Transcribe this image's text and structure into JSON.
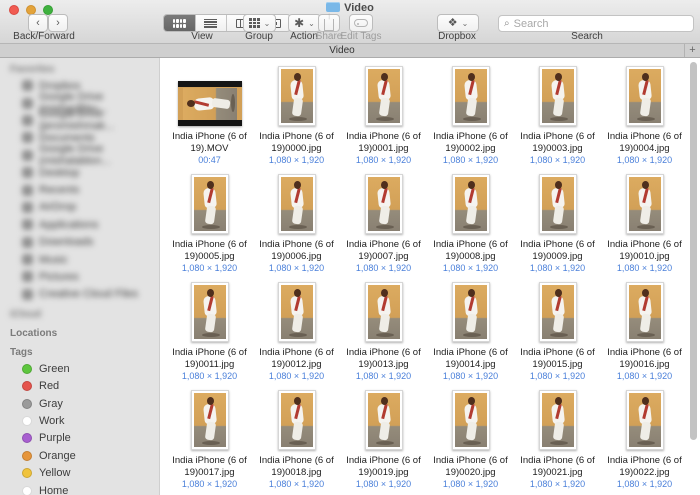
{
  "window": {
    "title": "Video"
  },
  "toolbar": {
    "back_forward_label": "Back/Forward",
    "view_label": "View",
    "group_label": "Group",
    "action_label": "Action",
    "share_label": "Share",
    "edit_tags_label": "Edit Tags",
    "dropbox_label": "Dropbox",
    "search_label": "Search",
    "search_placeholder": "Search",
    "back_glyph": "‹",
    "forward_glyph": "›",
    "chevron_glyph": "⌄",
    "gear_glyph": "✱",
    "dropbox_glyph": "❖",
    "magnifier_glyph": "⌕"
  },
  "tab_bar": {
    "tab_title": "Video",
    "new_tab_label": "+"
  },
  "sidebar": {
    "favorites_header": "Favorites",
    "favorites": [
      {
        "label": "Dropbox"
      },
      {
        "label": "Google Drive (mishaj@bu..."
      },
      {
        "label": "Google Drive (jeromishmak..."
      },
      {
        "label": "Documents"
      },
      {
        "label": "Google Drive (mishalablon..."
      },
      {
        "label": "Desktop"
      },
      {
        "label": "Recents"
      },
      {
        "label": "AirDrop"
      },
      {
        "label": "Applications"
      },
      {
        "label": "Downloads"
      },
      {
        "label": "Music"
      },
      {
        "label": "Pictures"
      },
      {
        "label": "Creative Cloud Files"
      }
    ],
    "icloud_header": "iCloud",
    "locations_header": "Locations",
    "tags_header": "Tags",
    "tags": [
      {
        "label": "Green",
        "color": "#5dc63e"
      },
      {
        "label": "Red",
        "color": "#e5544d"
      },
      {
        "label": "Gray",
        "color": "#9a9a9a"
      },
      {
        "label": "Work",
        "color": "#ffffff"
      },
      {
        "label": "Purple",
        "color": "#a85fd0"
      },
      {
        "label": "Orange",
        "color": "#e6953b"
      },
      {
        "label": "Yellow",
        "color": "#f0c33c"
      },
      {
        "label": "Home",
        "color": "#ffffff"
      }
    ]
  },
  "colors": {
    "accent_blue": "#4b80da",
    "folder_blue": "#7ab8e8"
  },
  "files": [
    {
      "type": "video",
      "line1": "India iPhone (6 of",
      "line2": "19).MOV",
      "meta": "00:47"
    },
    {
      "type": "image",
      "line1": "India iPhone (6 of",
      "line2": "19)0000.jpg",
      "meta": "1,080 × 1,920"
    },
    {
      "type": "image",
      "line1": "India iPhone (6 of",
      "line2": "19)0001.jpg",
      "meta": "1,080 × 1,920"
    },
    {
      "type": "image",
      "line1": "India iPhone (6 of",
      "line2": "19)0002.jpg",
      "meta": "1,080 × 1,920"
    },
    {
      "type": "image",
      "line1": "India iPhone (6 of",
      "line2": "19)0003.jpg",
      "meta": "1,080 × 1,920"
    },
    {
      "type": "image",
      "line1": "India iPhone (6 of",
      "line2": "19)0004.jpg",
      "meta": "1,080 × 1,920"
    },
    {
      "type": "image",
      "line1": "India iPhone (6 of",
      "line2": "19)0005.jpg",
      "meta": "1,080 × 1,920"
    },
    {
      "type": "image",
      "line1": "India iPhone (6 of",
      "line2": "19)0006.jpg",
      "meta": "1,080 × 1,920"
    },
    {
      "type": "image",
      "line1": "India iPhone (6 of",
      "line2": "19)0007.jpg",
      "meta": "1,080 × 1,920"
    },
    {
      "type": "image",
      "line1": "India iPhone (6 of",
      "line2": "19)0008.jpg",
      "meta": "1,080 × 1,920"
    },
    {
      "type": "image",
      "line1": "India iPhone (6 of",
      "line2": "19)0009.jpg",
      "meta": "1,080 × 1,920"
    },
    {
      "type": "image",
      "line1": "India iPhone (6 of",
      "line2": "19)0010.jpg",
      "meta": "1,080 × 1,920"
    },
    {
      "type": "image",
      "line1": "India iPhone (6 of",
      "line2": "19)0011.jpg",
      "meta": "1,080 × 1,920"
    },
    {
      "type": "image",
      "line1": "India iPhone (6 of",
      "line2": "19)0012.jpg",
      "meta": "1,080 × 1,920"
    },
    {
      "type": "image",
      "line1": "India iPhone (6 of",
      "line2": "19)0013.jpg",
      "meta": "1,080 × 1,920"
    },
    {
      "type": "image",
      "line1": "India iPhone (6 of",
      "line2": "19)0014.jpg",
      "meta": "1,080 × 1,920"
    },
    {
      "type": "image",
      "line1": "India iPhone (6 of",
      "line2": "19)0015.jpg",
      "meta": "1,080 × 1,920"
    },
    {
      "type": "image",
      "line1": "India iPhone (6 of",
      "line2": "19)0016.jpg",
      "meta": "1,080 × 1,920"
    },
    {
      "type": "image",
      "line1": "India iPhone (6 of",
      "line2": "19)0017.jpg",
      "meta": "1,080 × 1,920"
    },
    {
      "type": "image",
      "line1": "India iPhone (6 of",
      "line2": "19)0018.jpg",
      "meta": "1,080 × 1,920"
    },
    {
      "type": "image",
      "line1": "India iPhone (6 of",
      "line2": "19)0019.jpg",
      "meta": "1,080 × 1,920"
    },
    {
      "type": "image",
      "line1": "India iPhone (6 of",
      "line2": "19)0020.jpg",
      "meta": "1,080 × 1,920"
    },
    {
      "type": "image",
      "line1": "India iPhone (6 of",
      "line2": "19)0021.jpg",
      "meta": "1,080 × 1,920"
    },
    {
      "type": "image",
      "line1": "India iPhone (6 of",
      "line2": "19)0022.jpg",
      "meta": "1,080 × 1,920"
    }
  ]
}
